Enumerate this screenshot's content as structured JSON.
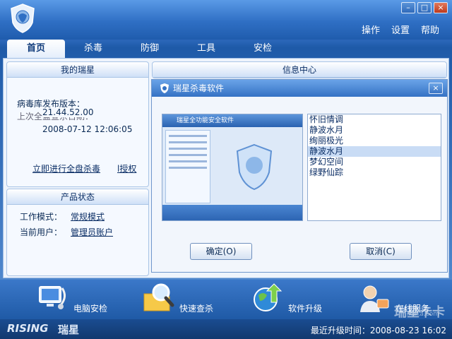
{
  "window": {
    "menu": [
      "操作",
      "设置",
      "帮助"
    ],
    "controls": [
      "–",
      "□",
      "×"
    ]
  },
  "tabs": [
    "首页",
    "杀毒",
    "防御",
    "工具",
    "安检"
  ],
  "left_panel": {
    "title": "我的瑞星",
    "virus_db_label": "病毒库发布版本：",
    "virus_db_version": "21.44.52.00",
    "last_scan_label": "上次全盘查杀日期：",
    "last_scan_date": "2008-07-12 12:06:05",
    "scan_link": "立即进行全盘杀毒",
    "auth_link": "l授权"
  },
  "product_panel": {
    "title": "产品状态",
    "mode_label": "工作模式：",
    "mode_value": "常规模式",
    "user_label": "当前用户：",
    "user_value": "管理员账户"
  },
  "info_center": {
    "title": "信息中心"
  },
  "dialog": {
    "title": "瑞星杀毒软件",
    "preview_title": "瑞星全功能安全软件",
    "skins": [
      "怀旧情调",
      "静波水月",
      "绚丽极光",
      "静波水月",
      "梦幻空间",
      "绿野仙踪"
    ],
    "selected_index": 3,
    "ok_label": "确定(O)",
    "cancel_label": "取消(C)"
  },
  "bottom": {
    "items": [
      "电脑安检",
      "快速查杀",
      "软件升级",
      "在线服务"
    ]
  },
  "statusbar": {
    "brand_en": "RISING",
    "brand_cn": "瑞星",
    "last_update": "最近升级时间：2008-08-23 16:02",
    "watermark": "瑞星卡卡",
    "watermark_url": "ikaka.com"
  },
  "colors": {
    "accent": "#2a66b8",
    "panel": "#f5f9ff",
    "selection": "#c9dcf5"
  }
}
